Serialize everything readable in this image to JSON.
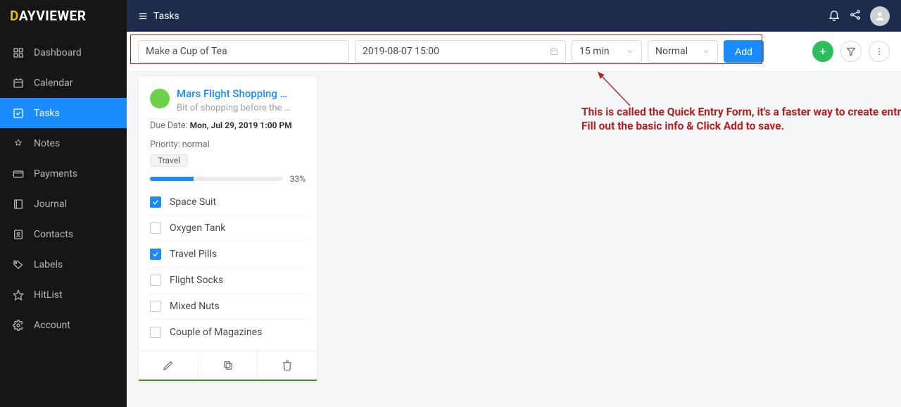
{
  "brand": {
    "d": "D",
    "rest": "AYVIEWER"
  },
  "header": {
    "title": "Tasks"
  },
  "nav": [
    {
      "label": "Dashboard"
    },
    {
      "label": "Calendar"
    },
    {
      "label": "Tasks"
    },
    {
      "label": "Notes"
    },
    {
      "label": "Payments"
    },
    {
      "label": "Journal"
    },
    {
      "label": "Contacts"
    },
    {
      "label": "Labels"
    },
    {
      "label": "HitList"
    },
    {
      "label": "Account"
    }
  ],
  "quick": {
    "title_value": "Make a Cup of Tea",
    "date_value": "2019-08-07 15:00",
    "duration": "15 min",
    "priority": "Normal",
    "add_label": "Add"
  },
  "annotation": "This is called the Quick Entry Form, it's a faster way to create entries. Fill out the basic info & Click Add to save.",
  "card": {
    "title": "Mars Flight Shopping …",
    "subtitle": "Bit of shopping before the …",
    "due_label": "Due Date: ",
    "due_value": "Mon, Jul 29, 2019 1:00 PM",
    "prio_label": "Priority: ",
    "prio_value": "normal",
    "tag": "Travel",
    "percent": "33%",
    "items": [
      {
        "label": "Space Suit",
        "checked": true
      },
      {
        "label": "Oxygen Tank",
        "checked": false
      },
      {
        "label": "Travel Pills",
        "checked": true
      },
      {
        "label": "Flight Socks",
        "checked": false
      },
      {
        "label": "Mixed Nuts",
        "checked": false
      },
      {
        "label": "Couple of Magazines",
        "checked": false
      }
    ]
  }
}
